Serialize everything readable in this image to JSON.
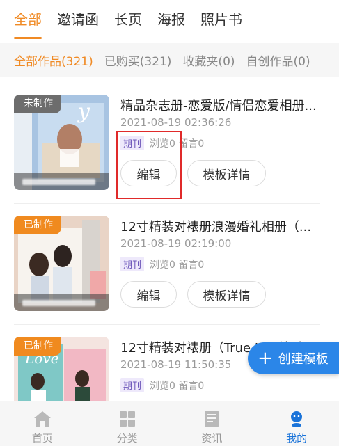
{
  "tabs": [
    {
      "label": "全部",
      "active": true
    },
    {
      "label": "邀请函",
      "active": false
    },
    {
      "label": "长页",
      "active": false
    },
    {
      "label": "海报",
      "active": false
    },
    {
      "label": "照片书",
      "active": false
    }
  ],
  "filters": [
    {
      "label": "全部作品(321)",
      "active": true
    },
    {
      "label": "已购买(321)",
      "active": false
    },
    {
      "label": "收藏夹(0)",
      "active": false
    },
    {
      "label": "自创作品(0)",
      "active": false
    }
  ],
  "cards": [
    {
      "status": "未制作",
      "title": "精品杂志册-恋爱版/情侣恋爱相册...",
      "time": "2021-08-19 02:36:26",
      "tag": "期刊",
      "stats": "浏览0 留言0",
      "edit_label": "编辑",
      "detail_label": "模板详情"
    },
    {
      "status": "已制作",
      "title": "12寸精装对裱册浪漫婚礼相册（...",
      "time": "2021-08-19 02:19:00",
      "tag": "期刊",
      "stats": "浏览0 留言0",
      "edit_label": "编辑",
      "detail_label": "模板详情"
    },
    {
      "status": "已制作",
      "title": "12寸精装对裱册（True L... 慧爱",
      "time": "2021-08-19 11:50:35",
      "tag": "期刊",
      "stats": "浏览0 留言0"
    }
  ],
  "fab": {
    "plus": "+",
    "label": "创建模板"
  },
  "bottom_nav": [
    {
      "label": "首页",
      "icon": "home-icon"
    },
    {
      "label": "分类",
      "icon": "grid-icon"
    },
    {
      "label": "资讯",
      "icon": "news-icon"
    },
    {
      "label": "我的",
      "icon": "user-icon",
      "active": true
    }
  ],
  "colors": {
    "accent": "#f08a24",
    "primary_blue": "#2b86e8",
    "highlight_red": "#e02a2a"
  }
}
